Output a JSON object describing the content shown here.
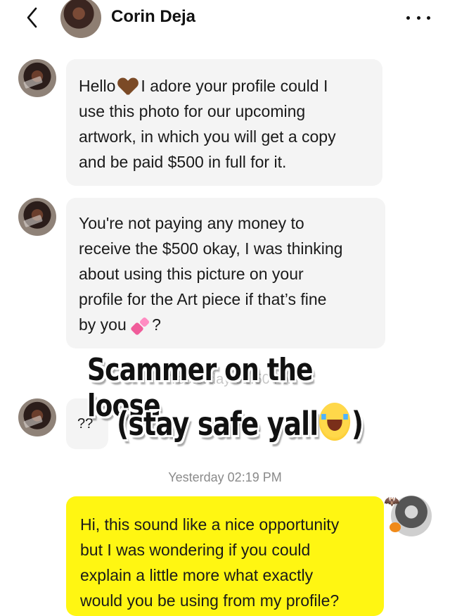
{
  "header": {
    "contact_name": "Corin Deja",
    "back_icon": "chevron-left-icon",
    "more_icon": "more-horizontal-icon"
  },
  "messages": [
    {
      "direction": "incoming",
      "lines": [
        "Hello",
        "I adore your profile could I",
        "use this photo for our upcoming",
        "artwork, in which you will get a copy",
        "and be paid $500 in full for it."
      ],
      "emoji": "brown-heart"
    },
    {
      "direction": "incoming",
      "lines": [
        "You're not paying any money to",
        "receive the $500 okay, I was thinking",
        "about using this picture on your",
        "profile for the Art piece if that’s fine",
        "by you",
        "?"
      ],
      "emoji": "two-hearts"
    },
    {
      "direction": "incoming",
      "text": "??"
    },
    {
      "direction": "outgoing",
      "lines": [
        "Hi, this sound like a nice opportunity",
        "but I was wondering if you could",
        "explain a little more what exactly",
        "would you be using from my profile?"
      ]
    }
  ],
  "timestamps": {
    "faded": "Yesterday 01:50 PM",
    "visible": "Yesterday 02:19 PM"
  },
  "overlay": {
    "line1": "Scammer on the loose",
    "line2_prefix": "(stay safe yall",
    "line2_suffix": ")",
    "emoji": "loudly-crying-face"
  },
  "colors": {
    "incoming_bubble": "#f4f4f4",
    "outgoing_bubble": "#fff612",
    "timestamp": "#8a8a8a"
  }
}
